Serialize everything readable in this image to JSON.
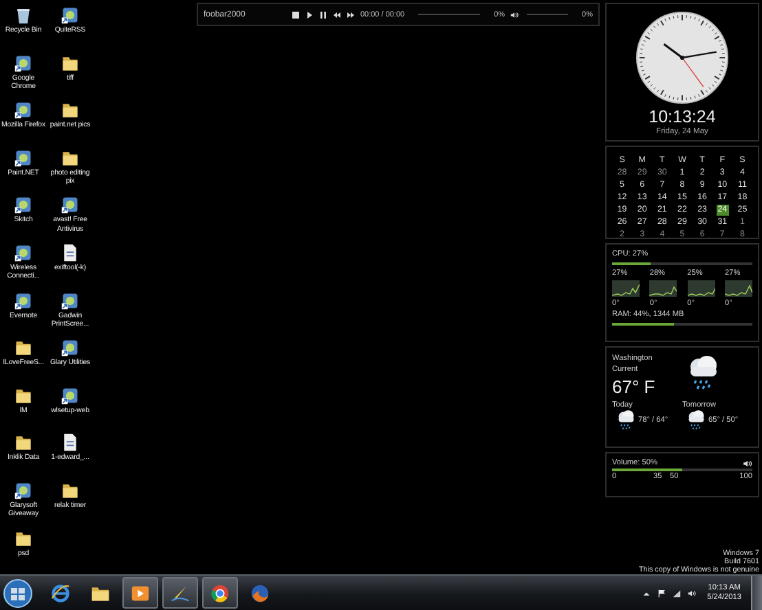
{
  "desktop_icons": [
    {
      "label": "Recycle Bin",
      "kind": "bin"
    },
    {
      "label": "QuiteRSS",
      "kind": "app"
    },
    {
      "label": "Google Chrome",
      "kind": "app"
    },
    {
      "label": "tiff",
      "kind": "folder"
    },
    {
      "label": "Mozilla Firefox",
      "kind": "app"
    },
    {
      "label": "paint.net pics",
      "kind": "folder"
    },
    {
      "label": "Paint.NET",
      "kind": "app"
    },
    {
      "label": "photo editing pix",
      "kind": "folder"
    },
    {
      "label": "Skitch",
      "kind": "app"
    },
    {
      "label": "avast! Free Antivirus",
      "kind": "app"
    },
    {
      "label": "Wireless Connecti...",
      "kind": "app"
    },
    {
      "label": "exiftool(-k)",
      "kind": "file"
    },
    {
      "label": "Evernote",
      "kind": "app"
    },
    {
      "label": "Gadwin PrintScree...",
      "kind": "app"
    },
    {
      "label": "ILoveFreeS...",
      "kind": "folder"
    },
    {
      "label": "Glary Utilities",
      "kind": "app"
    },
    {
      "label": "IM",
      "kind": "folder"
    },
    {
      "label": "wlsetup-web",
      "kind": "app"
    },
    {
      "label": "Inklik Data",
      "kind": "folder"
    },
    {
      "label": "1-edward_...",
      "kind": "file"
    },
    {
      "label": "Glarysoft Giveaway",
      "kind": "app"
    },
    {
      "label": "relak timer",
      "kind": "folder"
    },
    {
      "label": "psd",
      "kind": "folder"
    }
  ],
  "player": {
    "title": "foobar2000",
    "time": "00:00 / 00:00",
    "seek": {
      "level": 0,
      "reading": "0%"
    },
    "volume": {
      "level": 0,
      "reading": "0%"
    }
  },
  "clock": {
    "time": "10:13:24",
    "date": "Friday, 24 May"
  },
  "calendar": {
    "weekdays": [
      "S",
      "M",
      "T",
      "W",
      "T",
      "F",
      "S"
    ],
    "weeks": [
      [
        {
          "day": "28",
          "other_month": true,
          "selected": false
        },
        {
          "day": "29",
          "other_month": true,
          "selected": false
        },
        {
          "day": "30",
          "other_month": true,
          "selected": false
        },
        {
          "day": "1",
          "other_month": false,
          "selected": false
        },
        {
          "day": "2",
          "other_month": false,
          "selected": false
        },
        {
          "day": "3",
          "other_month": false,
          "selected": false
        },
        {
          "day": "4",
          "other_month": false,
          "selected": false
        }
      ],
      [
        {
          "day": "5",
          "other_month": false,
          "selected": false
        },
        {
          "day": "6",
          "other_month": false,
          "selected": false
        },
        {
          "day": "7",
          "other_month": false,
          "selected": false
        },
        {
          "day": "8",
          "other_month": false,
          "selected": false
        },
        {
          "day": "9",
          "other_month": false,
          "selected": false
        },
        {
          "day": "10",
          "other_month": false,
          "selected": false
        },
        {
          "day": "11",
          "other_month": false,
          "selected": false
        }
      ],
      [
        {
          "day": "12",
          "other_month": false,
          "selected": false
        },
        {
          "day": "13",
          "other_month": false,
          "selected": false
        },
        {
          "day": "14",
          "other_month": false,
          "selected": false
        },
        {
          "day": "15",
          "other_month": false,
          "selected": false
        },
        {
          "day": "16",
          "other_month": false,
          "selected": false
        },
        {
          "day": "17",
          "other_month": false,
          "selected": false
        },
        {
          "day": "18",
          "other_month": false,
          "selected": false
        }
      ],
      [
        {
          "day": "19",
          "other_month": false,
          "selected": false
        },
        {
          "day": "20",
          "other_month": false,
          "selected": false
        },
        {
          "day": "21",
          "other_month": false,
          "selected": false
        },
        {
          "day": "22",
          "other_month": false,
          "selected": false
        },
        {
          "day": "23",
          "other_month": false,
          "selected": false
        },
        {
          "day": "24",
          "other_month": false,
          "selected": true
        },
        {
          "day": "25",
          "other_month": false,
          "selected": false
        }
      ],
      [
        {
          "day": "26",
          "other_month": false,
          "selected": false
        },
        {
          "day": "27",
          "other_month": false,
          "selected": false
        },
        {
          "day": "28",
          "other_month": false,
          "selected": false
        },
        {
          "day": "29",
          "other_month": false,
          "selected": false
        },
        {
          "day": "30",
          "other_month": false,
          "selected": false
        },
        {
          "day": "31",
          "other_month": false,
          "selected": false
        },
        {
          "day": "1",
          "other_month": true,
          "selected": false
        }
      ],
      [
        {
          "day": "2",
          "other_month": true,
          "selected": false
        },
        {
          "day": "3",
          "other_month": true,
          "selected": false
        },
        {
          "day": "4",
          "other_month": true,
          "selected": false
        },
        {
          "day": "5",
          "other_month": true,
          "selected": false
        },
        {
          "day": "6",
          "other_month": true,
          "selected": false
        },
        {
          "day": "7",
          "other_month": true,
          "selected": false
        },
        {
          "day": "8",
          "other_month": true,
          "selected": false
        }
      ]
    ]
  },
  "cpu": {
    "label": "CPU: 27%",
    "level": 0.27,
    "cores": [
      {
        "load": "27%",
        "temp": "0°"
      },
      {
        "load": "28%",
        "temp": "0°"
      },
      {
        "load": "25%",
        "temp": "0°"
      },
      {
        "load": "27%",
        "temp": "0°"
      }
    ],
    "ram": {
      "label": "RAM: 44%, 1344 MB",
      "level": 0.44
    }
  },
  "weather": {
    "city": "Washington",
    "current_label": "Current",
    "temperature": "67° F",
    "forecast": [
      {
        "day": "Today",
        "range": "78° / 64°"
      },
      {
        "day": "Tomorrow",
        "range": "65° / 50°"
      }
    ]
  },
  "volume": {
    "label": "Volume: 50%",
    "level": 0.5,
    "scale": [
      "0",
      "35",
      "50",
      "100"
    ]
  },
  "os_notice": [
    "Windows 7",
    "Build 7601",
    "This copy of Windows is not genuine"
  ],
  "taskbar": {
    "buttons": [
      {
        "kind": "browser",
        "open": false
      },
      {
        "kind": "folder",
        "open": false
      },
      {
        "kind": "media",
        "open": true
      },
      {
        "kind": "pen",
        "open": true
      },
      {
        "kind": "chrome",
        "open": true
      },
      {
        "kind": "globe",
        "open": false
      }
    ],
    "time": "10:13 AM",
    "date": "5/24/2013"
  }
}
